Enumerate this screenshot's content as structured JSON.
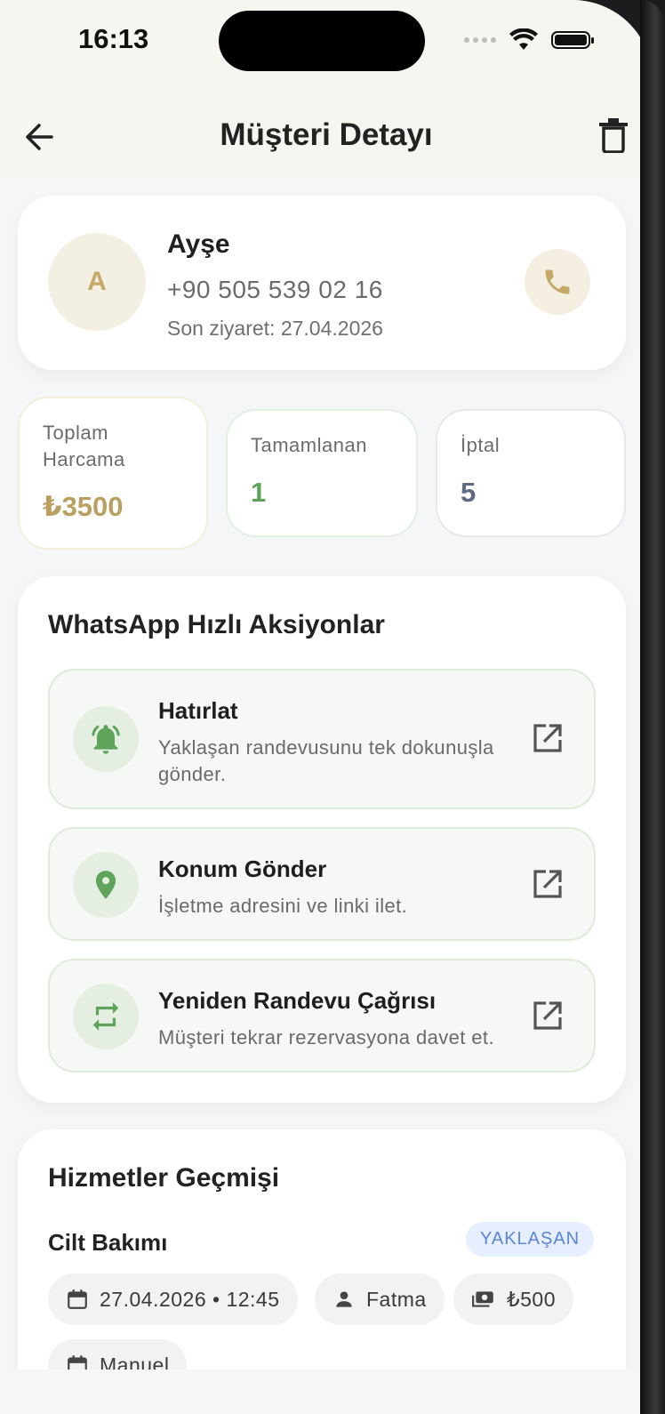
{
  "status_bar": {
    "time": "16:13"
  },
  "nav": {
    "title": "Müşteri Detayı"
  },
  "customer": {
    "initial": "A",
    "name": "Ayşe",
    "phone": "+90 505 539 02 16",
    "last_visit": "Son ziyaret: 27.04.2026"
  },
  "stats": [
    {
      "label": "Toplam Harcama",
      "value": "₺3500",
      "color": "#b9a061"
    },
    {
      "label": "Tamamlanan",
      "value": "1",
      "color": "#5da35a"
    },
    {
      "label": "İptal",
      "value": "5",
      "color": "#5f6a82"
    }
  ],
  "whatsapp": {
    "title": "WhatsApp Hızlı Aksiyonlar",
    "actions": [
      {
        "title": "Hatırlat",
        "desc": "Yaklaşan randevusunu tek dokunuşla gönder.",
        "icon": "bell-icon"
      },
      {
        "title": "Konum Gönder",
        "desc": "İşletme adresini ve linki ilet.",
        "icon": "location-pin-icon"
      },
      {
        "title": "Yeniden Randevu Çağrısı",
        "desc": "Müşteri tekrar rezervasyona davet et.",
        "icon": "repeat-icon"
      }
    ]
  },
  "history": {
    "title": "Hizmetler Geçmişi",
    "items": [
      {
        "service": "Cilt Bakımı",
        "status": "YAKLAŞAN",
        "datetime": "27.04.2026 • 12:45",
        "staff": "Fatma",
        "price": "₺500",
        "source": "Manuel"
      }
    ]
  },
  "colors": {
    "accent_gold": "#c6a968",
    "whatsapp_green": "#5ea45a",
    "badge_blue": "#5a86d6"
  }
}
